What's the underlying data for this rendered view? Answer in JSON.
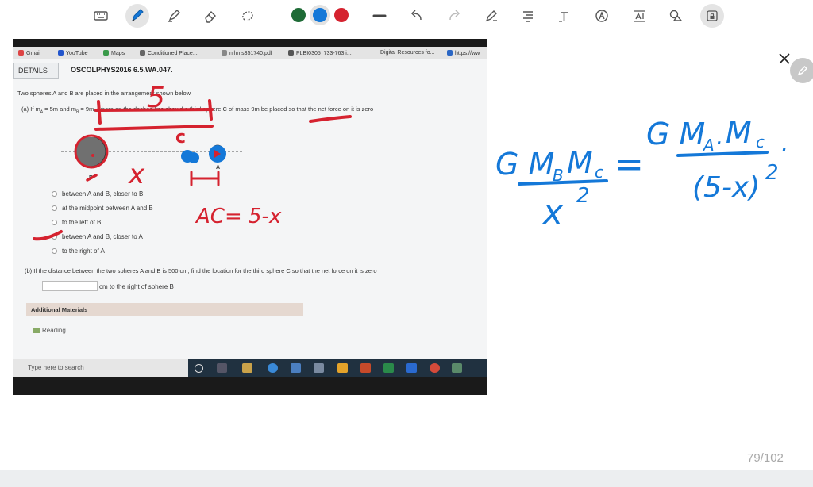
{
  "toolbar": {
    "tools": [
      {
        "icon": "keyboard-icon"
      },
      {
        "icon": "pen-icon",
        "active": true
      },
      {
        "icon": "highlighter-icon"
      },
      {
        "icon": "eraser-icon"
      },
      {
        "icon": "lasso-icon"
      },
      {
        "icon": "line-tool-icon"
      },
      {
        "icon": "undo-icon"
      },
      {
        "icon": "redo-icon"
      },
      {
        "icon": "pen-settings-icon"
      },
      {
        "icon": "text-align-icon"
      },
      {
        "icon": "text-tool-icon"
      },
      {
        "icon": "handwriting-icon"
      },
      {
        "icon": "text-spacing-icon"
      },
      {
        "icon": "shapes-icon"
      },
      {
        "icon": "lock-icon"
      }
    ],
    "colors": [
      {
        "name": "green",
        "hex": "#1e6b36"
      },
      {
        "name": "blue",
        "hex": "#1478d8",
        "selected": true
      },
      {
        "name": "red",
        "hex": "#d5222f"
      }
    ]
  },
  "browser": {
    "bookmarks": [
      "Gmail",
      "YouTube",
      "Maps",
      "Conditioned Place...",
      "nihms351740.pdf",
      "PLBI0305_733-763.i...",
      "Digital Resources fo...",
      "https://ww"
    ],
    "details_tab": "DETAILS",
    "problem_code": "OSCOLPHYS2016 6.5.WA.047."
  },
  "problem": {
    "intro": "Two spheres A and B are placed in the arrangement shown below.",
    "part_a": "(a)   If m",
    "part_a_rest": " = 5m and m",
    "part_a_rest2": " = 9m, where on the dashed line should a third sphere C of mass 9m be placed so that the net force on it is zero",
    "sub_a": "A",
    "sub_b": "B",
    "label_b": "B",
    "label_a": "A",
    "options": [
      "between A and B, closer to B",
      "at the midpoint between A and B",
      "to the left of B",
      "between A and B, closer to A",
      "to the right of A"
    ],
    "part_b": "(b)   If the distance between the two spheres A and B is 500 cm, find the location for the third sphere C so that the net force on it is zero",
    "part_b_unit": "cm to the right of sphere B",
    "additional_materials": "Additional Materials",
    "reading": "Reading",
    "taskbar_search": "Type here to search"
  },
  "annotations": {
    "left": {
      "five": "5",
      "c": "c",
      "x": "x",
      "ac": "AC= 5-x"
    },
    "equation": {
      "lhs_num": "G M",
      "lhs_sub1": "B",
      "lhs_m": "M",
      "lhs_sub2": "c",
      "lhs_den": "x",
      "lhs_exp": "2",
      "equals": "=",
      "rhs_num": "G M",
      "rhs_sub1": "A",
      "rhs_dot": ".",
      "rhs_m": "M",
      "rhs_sub2": "c",
      "rhs_den": "(5-x)",
      "rhs_exp": "2",
      "rhs_tail": "."
    }
  },
  "page": {
    "counter": "79/102"
  }
}
